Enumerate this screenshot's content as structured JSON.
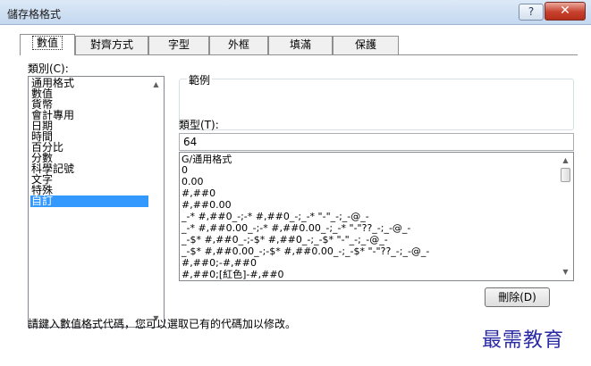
{
  "window": {
    "title": "儲存格格式",
    "help_label": "?",
    "close_label": "✕"
  },
  "tabs": [
    {
      "label": "數值",
      "active": true
    },
    {
      "label": "對齊方式",
      "active": false
    },
    {
      "label": "字型",
      "active": false
    },
    {
      "label": "外框",
      "active": false
    },
    {
      "label": "填滿",
      "active": false
    },
    {
      "label": "保護",
      "active": false
    }
  ],
  "category": {
    "label": "類別(C):",
    "items": [
      "通用格式",
      "數值",
      "貨幣",
      "會計專用",
      "日期",
      "時間",
      "百分比",
      "分數",
      "科學記號",
      "文字",
      "特殊",
      "自訂"
    ],
    "selected": "自訂"
  },
  "sample": {
    "label": "範例"
  },
  "type": {
    "label": "類型(T):",
    "value": "64",
    "formats": [
      "G/通用格式",
      "0",
      "0.00",
      "#,##0",
      "#,##0.00",
      "_-* #,##0_-;-* #,##0_-;_-* \"-\"_-;_-@_-",
      "_-* #,##0.00_-;-* #,##0.00_-;_-* \"-\"??_-;_-@_-",
      "_-$* #,##0_-;-$* #,##0_-;_-$* \"-\"_-;_-@_-",
      "_-$* #,##0.00_-;-$* #,##0.00_-;_-$* \"-\"??_-;_-@_-",
      "#,##0;-#,##0",
      "#,##0;[紅色]-#,##0"
    ]
  },
  "delete_button": "刪除(D)",
  "hint": "請鍵入數值格式代碼，您可以選取已有的代碼加以修改。",
  "watermark": "最需教育",
  "colors": {
    "selection": "#3399ff",
    "watermark": "#2a2aa5",
    "close_button": "#c7412d"
  }
}
